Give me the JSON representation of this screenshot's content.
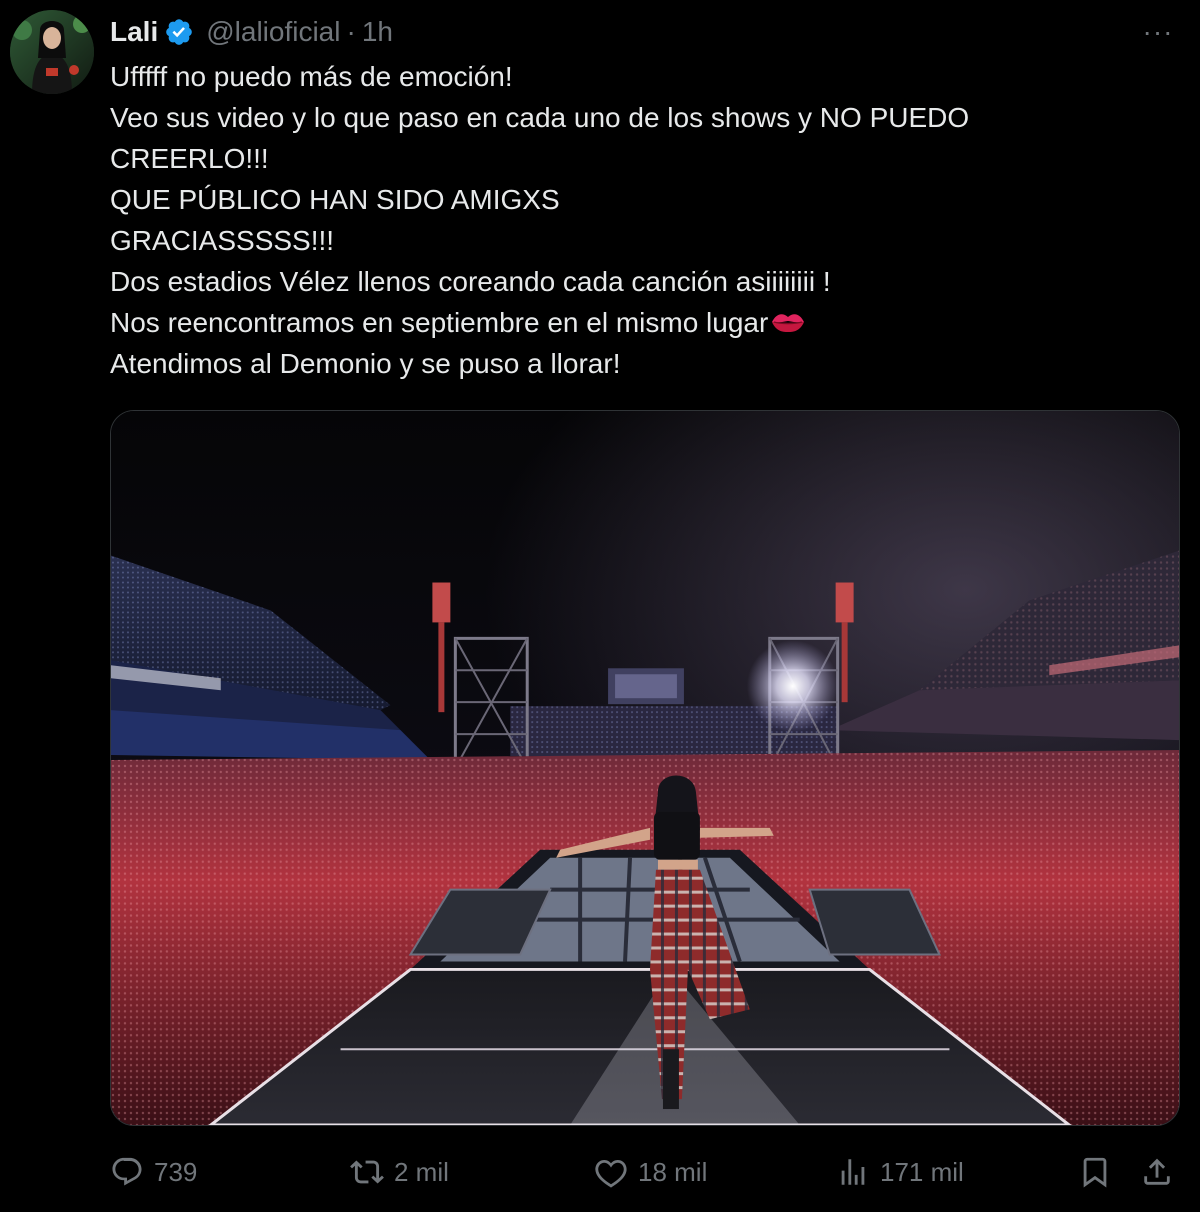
{
  "author": {
    "name": "Lali",
    "handle": "@lalioficial",
    "separator": "·",
    "time": "1h",
    "verified": true
  },
  "menu": {
    "more_label": "···"
  },
  "text_lines": [
    "Ufffff no puedo más de emoción!",
    "Veo sus video y lo que paso en cada uno de los shows y NO PUEDO",
    "CREERLO!!!",
    "QUE PÚBLICO HAN SIDO AMIGXS",
    "GRACIASSSSS!!!",
    "Dos estadios Vélez llenos coreando cada canción asiiiiiiii !",
    "Nos reencontramos en septiembre en el mismo lugar",
    "Atendimos al Demonio y se puso a llorar!"
  ],
  "emoji": {
    "line7_suffix": "kiss-mark"
  },
  "actions": {
    "replies": "739",
    "reposts": "2 mil",
    "likes": "18 mil",
    "views": "171 mil"
  },
  "icons": {
    "verified": "verified-badge-icon",
    "reply": "reply-bubble-icon",
    "repost": "repost-icon",
    "like": "heart-icon",
    "views": "views-chart-icon",
    "bookmark": "bookmark-icon",
    "share": "share-icon",
    "more": "more-dots-icon"
  },
  "colors": {
    "background": "#000000",
    "text": "#e7e9ea",
    "muted": "#71767b",
    "verified_blue": "#1d9bf0",
    "border": "#2f3336"
  }
}
